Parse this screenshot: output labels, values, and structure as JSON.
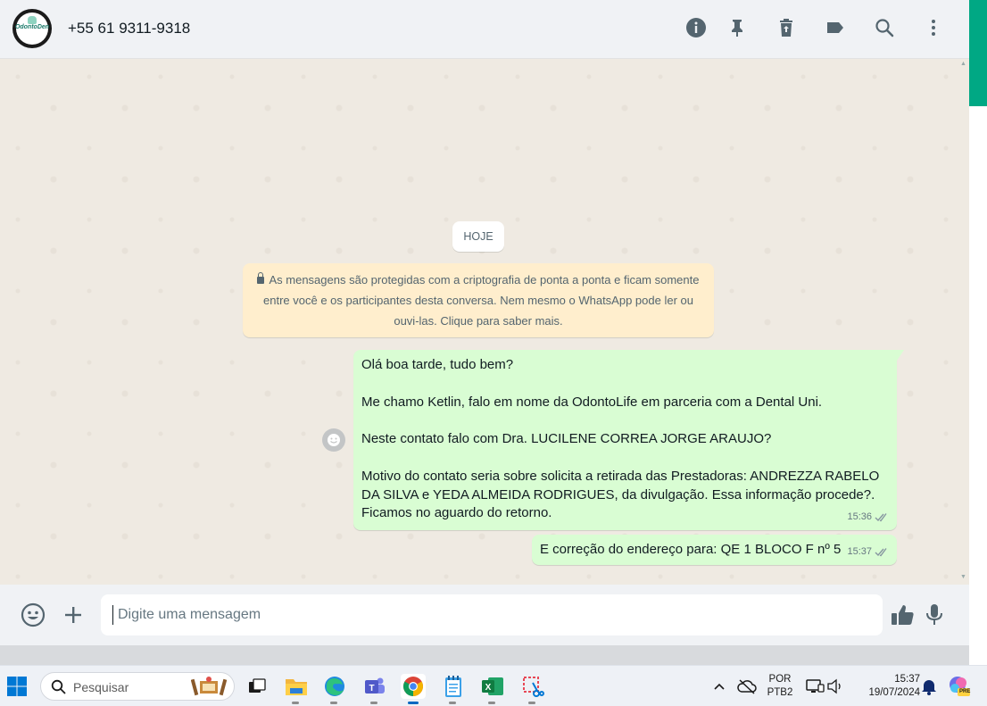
{
  "header": {
    "contact_name": "+55 61 9311-9318",
    "avatar_text": "OdontoDen",
    "icons": [
      "info-icon",
      "pin-icon",
      "delete-icon",
      "label-icon",
      "search-icon",
      "menu-icon"
    ]
  },
  "chat": {
    "date_chip": "HOJE",
    "e2e_notice": "As mensagens são protegidas com a criptografia de ponta a ponta e ficam somente entre você e os participantes desta conversa. Nem mesmo o WhatsApp pode ler ou ouvi-las. Clique para saber mais.",
    "messages": [
      {
        "direction": "outgoing",
        "lines": [
          "Olá boa tarde, tudo bem?",
          "",
          "Me chamo Ketlin, falo em nome da OdontoLife em parceria com a Dental Uni.",
          "",
          "Neste contato falo com Dra. LUCILENE CORREA JORGE ARAUJO?",
          "",
          "Motivo do contato seria sobre solicita a retirada das Prestadoras: ANDREZZA RABELO DA SILVA e YEDA ALMEIDA RODRIGUES, da divulgação. Essa informação procede?.",
          "Ficamos no aguardo do retorno."
        ],
        "time": "15:36",
        "status": "read"
      },
      {
        "direction": "outgoing",
        "text": "E correção do endereço para: QE 1 BLOCO F nº 5",
        "time": "15:37",
        "status": "read"
      }
    ]
  },
  "composer": {
    "placeholder": "Digite uma mensagem"
  },
  "taskbar": {
    "search_label": "Pesquisar",
    "lang_top": "POR",
    "lang_bottom": "PTB2",
    "time": "15:37",
    "date": "19/07/2024",
    "copilot_badge": "PRE"
  },
  "colors": {
    "accent": "#00a884",
    "outgoing_bubble": "#d9fdd3",
    "notice_bubble": "#ffeecd",
    "chat_background": "#efeae2"
  }
}
